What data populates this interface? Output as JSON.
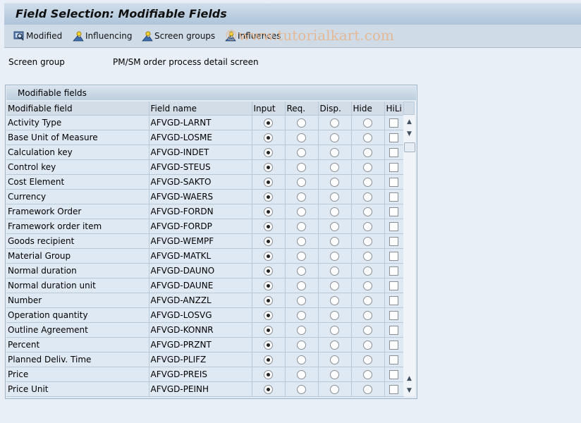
{
  "window": {
    "title": "Field Selection: Modifiable Fields"
  },
  "toolbar": {
    "buttons": [
      {
        "label": "Modified",
        "icon": "display-icon"
      },
      {
        "label": "Influencing",
        "icon": "person-icon"
      },
      {
        "label": "Screen groups",
        "icon": "person-icon"
      },
      {
        "label": "Influences",
        "icon": "person-icon"
      }
    ]
  },
  "watermark": "©www.tutorialkart.com",
  "info": {
    "label": "Screen group",
    "value": "PM/SM order process detail screen"
  },
  "panel": {
    "title": "Modifiable fields",
    "columns": [
      "Modifiable field",
      "Field name",
      "Input",
      "Req.",
      "Disp.",
      "Hide",
      "HiLi"
    ],
    "rows": [
      {
        "field": "Activity Type",
        "name": "AFVGD-LARNT",
        "selected": "Input",
        "hili": false
      },
      {
        "field": "Base Unit of Measure",
        "name": "AFVGD-LOSME",
        "selected": "Input",
        "hili": false
      },
      {
        "field": "Calculation key",
        "name": "AFVGD-INDET",
        "selected": "Input",
        "hili": false
      },
      {
        "field": "Control key",
        "name": "AFVGD-STEUS",
        "selected": "Input",
        "hili": false
      },
      {
        "field": "Cost Element",
        "name": "AFVGD-SAKTO",
        "selected": "Input",
        "hili": false
      },
      {
        "field": "Currency",
        "name": "AFVGD-WAERS",
        "selected": "Input",
        "hili": false
      },
      {
        "field": "Framework Order",
        "name": "AFVGD-FORDN",
        "selected": "Input",
        "hili": false
      },
      {
        "field": "Framework order item",
        "name": "AFVGD-FORDP",
        "selected": "Input",
        "hili": false
      },
      {
        "field": "Goods recipient",
        "name": "AFVGD-WEMPF",
        "selected": "Input",
        "hili": false
      },
      {
        "field": "Material Group",
        "name": "AFVGD-MATKL",
        "selected": "Input",
        "hili": false
      },
      {
        "field": "Normal duration",
        "name": "AFVGD-DAUNO",
        "selected": "Input",
        "hili": false
      },
      {
        "field": "Normal duration unit",
        "name": "AFVGD-DAUNE",
        "selected": "Input",
        "hili": false
      },
      {
        "field": "Number",
        "name": "AFVGD-ANZZL",
        "selected": "Input",
        "hili": false
      },
      {
        "field": "Operation quantity",
        "name": "AFVGD-LOSVG",
        "selected": "Input",
        "hili": false
      },
      {
        "field": "Outline Agreement",
        "name": "AFVGD-KONNR",
        "selected": "Input",
        "hili": false
      },
      {
        "field": "Percent",
        "name": "AFVGD-PRZNT",
        "selected": "Input",
        "hili": false
      },
      {
        "field": "Planned Deliv. Time",
        "name": "AFVGD-PLIFZ",
        "selected": "Input",
        "hili": false
      },
      {
        "field": "Price",
        "name": "AFVGD-PREIS",
        "selected": "Input",
        "hili": false
      },
      {
        "field": "Price Unit",
        "name": "AFVGD-PEINH",
        "selected": "Input",
        "hili": false
      }
    ]
  }
}
